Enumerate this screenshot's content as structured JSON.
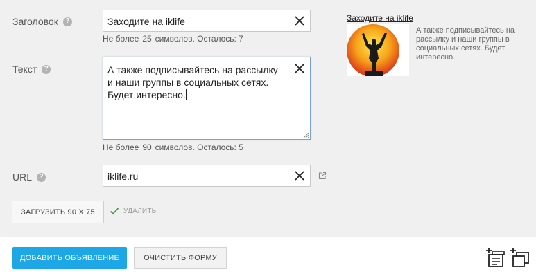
{
  "form": {
    "title": {
      "label": "Заголовок",
      "help": "?",
      "value": "Заходите на iklife",
      "hint_prefix": "Не более",
      "hint_max": "25",
      "hint_suffix": "символов. Осталось: 7"
    },
    "text": {
      "label": "Текст",
      "help": "?",
      "value": "А также подписывайтесь на рассылку\nи наши группы в социальных сетях.\nБудет интересно.",
      "hint_prefix": "Не более",
      "hint_max": "90",
      "hint_suffix": "символов. Осталось: 5"
    },
    "url": {
      "label": "URL",
      "help": "?",
      "value": "iklife.ru"
    },
    "upload_button": "ЗАГРУЗИТЬ 90 X 75",
    "delete_link": "УДАЛИТЬ"
  },
  "preview": {
    "title": "Заходите на iklife",
    "text": "А также подписывайтесь на рассылку и наши группы в социальных сетях. Будет интересно."
  },
  "actions": {
    "add": "ДОБАВИТЬ ОБЪЯВЛЕНИЕ",
    "clear": "ОЧИСТИТЬ ФОРМУ"
  },
  "colors": {
    "accent": "#1ea7e6",
    "form_bg": "#f0f0f0",
    "check": "#2e9e2e"
  },
  "icons": {
    "clear": "close-icon",
    "external": "external-link-icon",
    "check": "check-icon",
    "add_ad": "add-ad-icon",
    "duplicate": "duplicate-ad-icon"
  }
}
